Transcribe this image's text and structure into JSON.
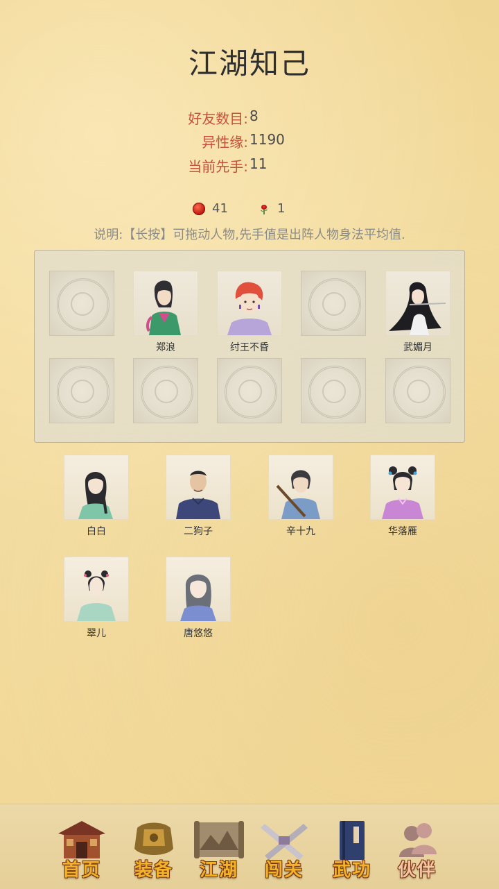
{
  "page": {
    "title": "江湖知己"
  },
  "stats": [
    {
      "label": "好友数目:",
      "value": "8"
    },
    {
      "label": "异性缘:",
      "value": "1190"
    },
    {
      "label": "当前先手:",
      "value": "11"
    }
  ],
  "counters": {
    "gift": {
      "icon": "red-gift-icon",
      "value": "41"
    },
    "rose": {
      "icon": "rose-icon",
      "value": "1"
    }
  },
  "note": "说明:【长按】可拖动人物,先手值是出阵人物身法平均值.",
  "formation": {
    "row1": [
      {
        "name": "",
        "empty": true
      },
      {
        "name": "郑浪",
        "empty": false
      },
      {
        "name": "纣王不昏",
        "empty": false
      },
      {
        "name": "",
        "empty": true
      },
      {
        "name": "武媚月",
        "empty": false
      }
    ],
    "row2": [
      {
        "name": "",
        "empty": true
      },
      {
        "name": "",
        "empty": true
      },
      {
        "name": "",
        "empty": true
      },
      {
        "name": "",
        "empty": true
      },
      {
        "name": "",
        "empty": true
      }
    ]
  },
  "bench": [
    {
      "name": "白白"
    },
    {
      "name": "二狗子"
    },
    {
      "name": "辛十九"
    },
    {
      "name": "华落雁"
    },
    {
      "name": "翠儿"
    },
    {
      "name": "唐悠悠"
    }
  ],
  "nav": [
    {
      "label": "首页",
      "icon": "house-icon"
    },
    {
      "label": "装备",
      "icon": "armor-icon"
    },
    {
      "label": "江湖",
      "icon": "scroll-map-icon"
    },
    {
      "label": "闯关",
      "icon": "crossed-swords-icon"
    },
    {
      "label": "武功",
      "icon": "book-icon"
    },
    {
      "label": "伙伴",
      "icon": "partners-icon",
      "active": true
    }
  ]
}
